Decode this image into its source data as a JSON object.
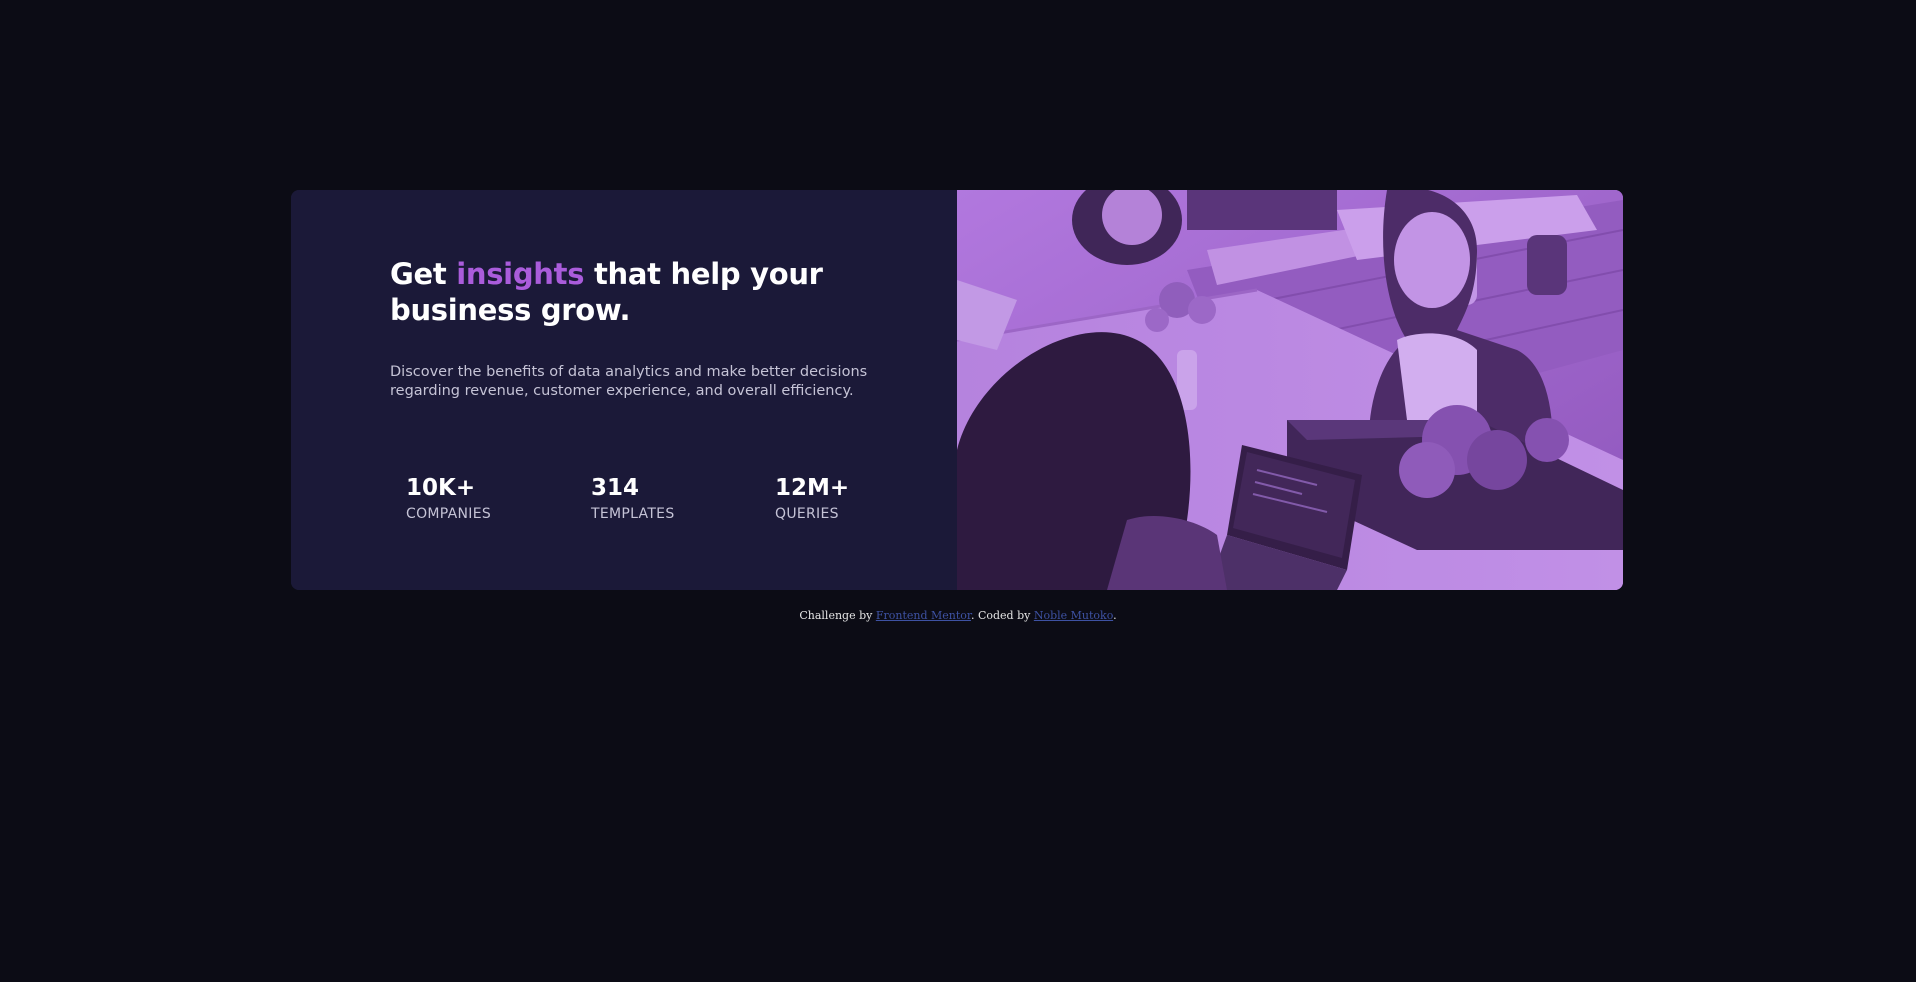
{
  "card": {
    "headline": {
      "before": "Get ",
      "accent": "insights",
      "after": " that help your business grow."
    },
    "description": "Discover the benefits of data analytics and make better decisions regarding revenue, customer experience, and overall efficiency.",
    "stats": [
      {
        "value": "10K+",
        "label": "COMPANIES"
      },
      {
        "value": "314",
        "label": "TEMPLATES"
      },
      {
        "value": "12M+",
        "label": "QUERIES"
      }
    ]
  },
  "footer": {
    "prefix": "Challenge by ",
    "link1": "Frontend Mentor",
    "middle": ". Coded by ",
    "link2": "Noble Mutoko",
    "suffix": "."
  },
  "colors": {
    "page_bg": "#0c0c15",
    "card_bg": "#1b1938",
    "accent": "#aa5cdb",
    "image_overlay": "#a065cc",
    "link": "#3e52a3"
  }
}
